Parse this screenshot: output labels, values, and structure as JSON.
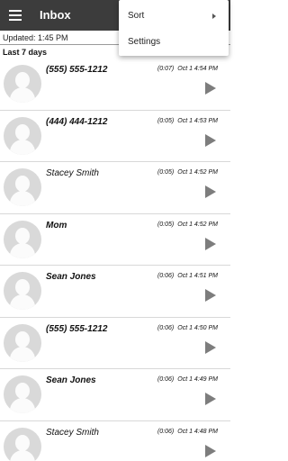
{
  "appbar": {
    "title": "Inbox"
  },
  "status": {
    "updated": "Updated: 1:45 PM"
  },
  "section": {
    "header": "Last 7 days"
  },
  "menu": {
    "items": [
      {
        "label": "Sort"
      },
      {
        "label": "Settings"
      }
    ]
  },
  "messages": [
    {
      "name": "(555) 555-1212",
      "duration": "(0:07)",
      "timestamp": "Oct 1 4:54 PM"
    },
    {
      "name": "(444) 444-1212",
      "duration": "(0:05)",
      "timestamp": "Oct 1 4:53 PM"
    },
    {
      "name": "Stacey Smith",
      "duration": "(0:05)",
      "timestamp": "Oct 1 4:52 PM"
    },
    {
      "name": "Mom",
      "duration": "(0:05)",
      "timestamp": "Oct 1 4:52 PM"
    },
    {
      "name": "Sean Jones",
      "duration": "(0:06)",
      "timestamp": "Oct 1 4:51 PM"
    },
    {
      "name": "(555) 555-1212",
      "duration": "(0:06)",
      "timestamp": "Oct 1 4:50 PM"
    },
    {
      "name": "Sean Jones",
      "duration": "(0:06)",
      "timestamp": "Oct 1 4:49 PM"
    },
    {
      "name": "Stacey Smith",
      "duration": "(0:06)",
      "timestamp": "Oct 1 4:48 PM"
    }
  ]
}
